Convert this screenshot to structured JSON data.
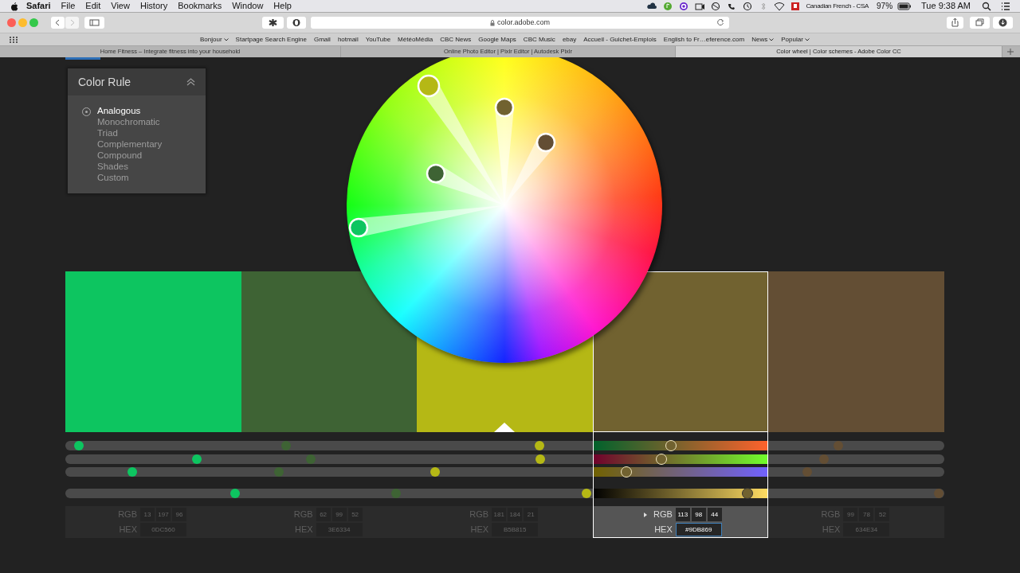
{
  "menubar": {
    "app": "Safari",
    "menus": [
      "File",
      "Edit",
      "View",
      "History",
      "Bookmarks",
      "Window",
      "Help"
    ],
    "input_source": "Canadian French - CSA",
    "battery": "97%",
    "clock": "Tue 9:38 AM"
  },
  "browser": {
    "url": "color.adobe.com",
    "bookmarks": [
      {
        "label": "Bonjour",
        "has_menu": true
      },
      {
        "label": "Startpage Search Engine",
        "has_menu": false
      },
      {
        "label": "Gmail",
        "has_menu": false
      },
      {
        "label": "hotmail",
        "has_menu": false
      },
      {
        "label": "YouTube",
        "has_menu": false
      },
      {
        "label": "MétéoMédia",
        "has_menu": false
      },
      {
        "label": "CBC News",
        "has_menu": false
      },
      {
        "label": "Google Maps",
        "has_menu": false
      },
      {
        "label": "CBC Music",
        "has_menu": false
      },
      {
        "label": "ebay",
        "has_menu": false
      },
      {
        "label": "Accueil - Guichet-Emplois",
        "has_menu": false
      },
      {
        "label": "English to Fr…eference.com",
        "has_menu": false
      },
      {
        "label": "News",
        "has_menu": true
      },
      {
        "label": "Popular",
        "has_menu": true
      }
    ],
    "tabs": [
      {
        "title": "Home Fitness – Integrate fitness into your household",
        "selected": false
      },
      {
        "title": "Online Photo Editor | Pixlr Editor | Autodesk Pixlr",
        "selected": false
      },
      {
        "title": "Color wheel | Color schemes - Adobe Color CC",
        "selected": true
      }
    ]
  },
  "color_rule": {
    "title": "Color Rule",
    "options": [
      {
        "label": "Analogous",
        "selected": true
      },
      {
        "label": "Monochromatic",
        "selected": false
      },
      {
        "label": "Triad",
        "selected": false
      },
      {
        "label": "Complementary",
        "selected": false
      },
      {
        "label": "Compound",
        "selected": false
      },
      {
        "label": "Shades",
        "selected": false
      },
      {
        "label": "Custom",
        "selected": false
      }
    ]
  },
  "swatches": [
    {
      "color": "#0dc560",
      "selected": false,
      "base": false,
      "rgb": [
        "13",
        "197",
        "96"
      ],
      "hex": "0DC560",
      "sliders": [
        {
          "level": 0.015
        },
        {
          "level": 0.15
        },
        {
          "level": 0.076
        },
        {
          "level": 0.193
        }
      ]
    },
    {
      "color": "#3e6334",
      "selected": false,
      "base": false,
      "rgb": [
        "62",
        "99",
        "52"
      ],
      "hex": "3E6334",
      "sliders": [
        {
          "level": 0.251
        },
        {
          "level": 0.279
        },
        {
          "level": 0.243
        },
        {
          "level": 0.376
        }
      ]
    },
    {
      "color": "#b5b815",
      "selected": false,
      "base": true,
      "rgb": [
        "181",
        "184",
        "21"
      ],
      "hex": "B5B815",
      "sliders": [
        {
          "level": 0.539
        },
        {
          "level": 0.54
        },
        {
          "level": 0.421
        },
        {
          "level": 0.593
        }
      ]
    },
    {
      "color": "#716230",
      "selected": true,
      "base": false,
      "rgb": [
        "113",
        "98",
        "44"
      ],
      "hex": "#9DB869",
      "sliders": [
        {
          "level": 0.445
        },
        {
          "level": 0.391
        },
        {
          "level": 0.191
        },
        {
          "level": 0.882
        }
      ]
    },
    {
      "color": "#634e34",
      "selected": false,
      "base": false,
      "rgb": [
        "99",
        "78",
        "52"
      ],
      "hex": "634E34",
      "sliders": [
        {
          "level": 0.879
        },
        {
          "level": 0.863
        },
        {
          "level": 0.844
        },
        {
          "level": 0.994
        }
      ]
    }
  ],
  "value_labels": [
    {
      "rgb": "RGB",
      "hex": "HEX"
    },
    {
      "rgb": "RGB",
      "hex": "HEX"
    },
    {
      "rgb": "RGB",
      "hex": "HEX"
    },
    {
      "rgb": "RGB",
      "hex": "HEX"
    },
    {
      "rgb": "RGB",
      "hex": "HEX"
    }
  ]
}
